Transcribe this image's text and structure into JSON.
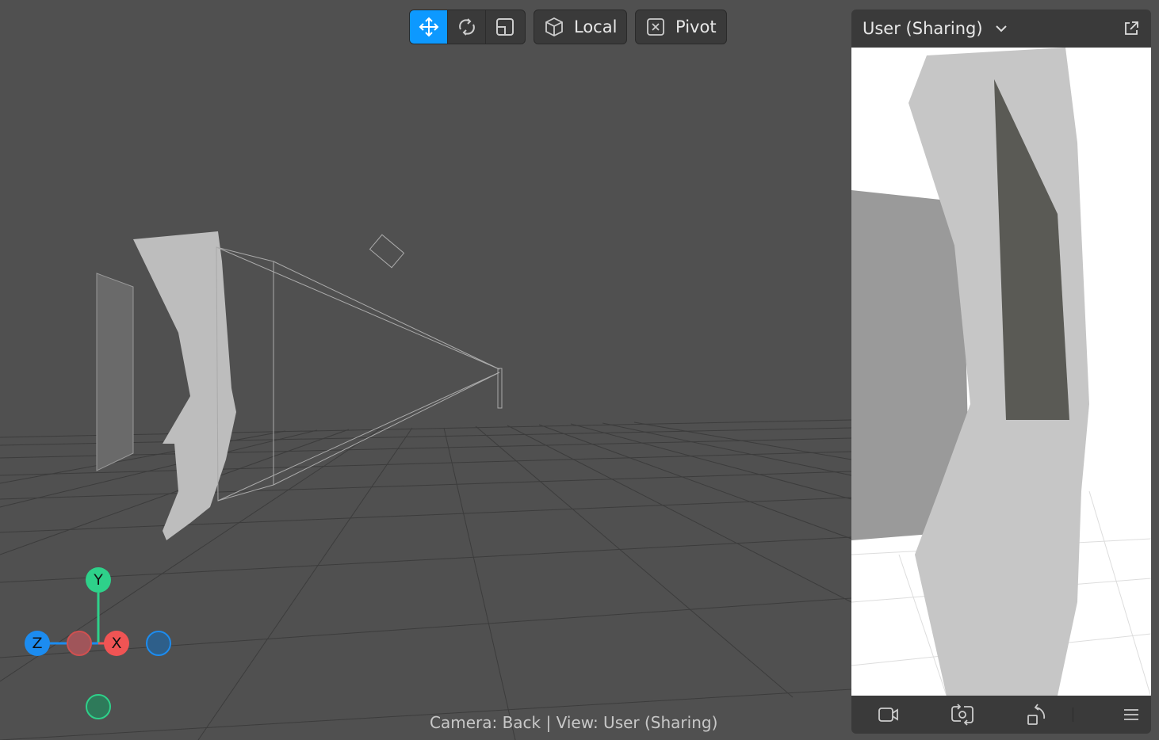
{
  "toolbar": {
    "tools": [
      {
        "name": "move",
        "active": true
      },
      {
        "name": "rotate",
        "active": false
      },
      {
        "name": "scale",
        "active": false
      }
    ],
    "space_label": "Local",
    "pivot_label": "Pivot"
  },
  "preview": {
    "title": "User (Sharing)",
    "footer_buttons": [
      "camera-icon",
      "switch-camera-icon",
      "reset-view-icon",
      "menu-icon"
    ]
  },
  "gizmo": {
    "y": "Y",
    "z": "Z",
    "x": "X"
  },
  "status": "Camera: Back | View: User (Sharing)",
  "colors": {
    "accent": "#0d99ff",
    "x": "#f05454",
    "y": "#2ed18a",
    "z": "#1c8cf0"
  }
}
